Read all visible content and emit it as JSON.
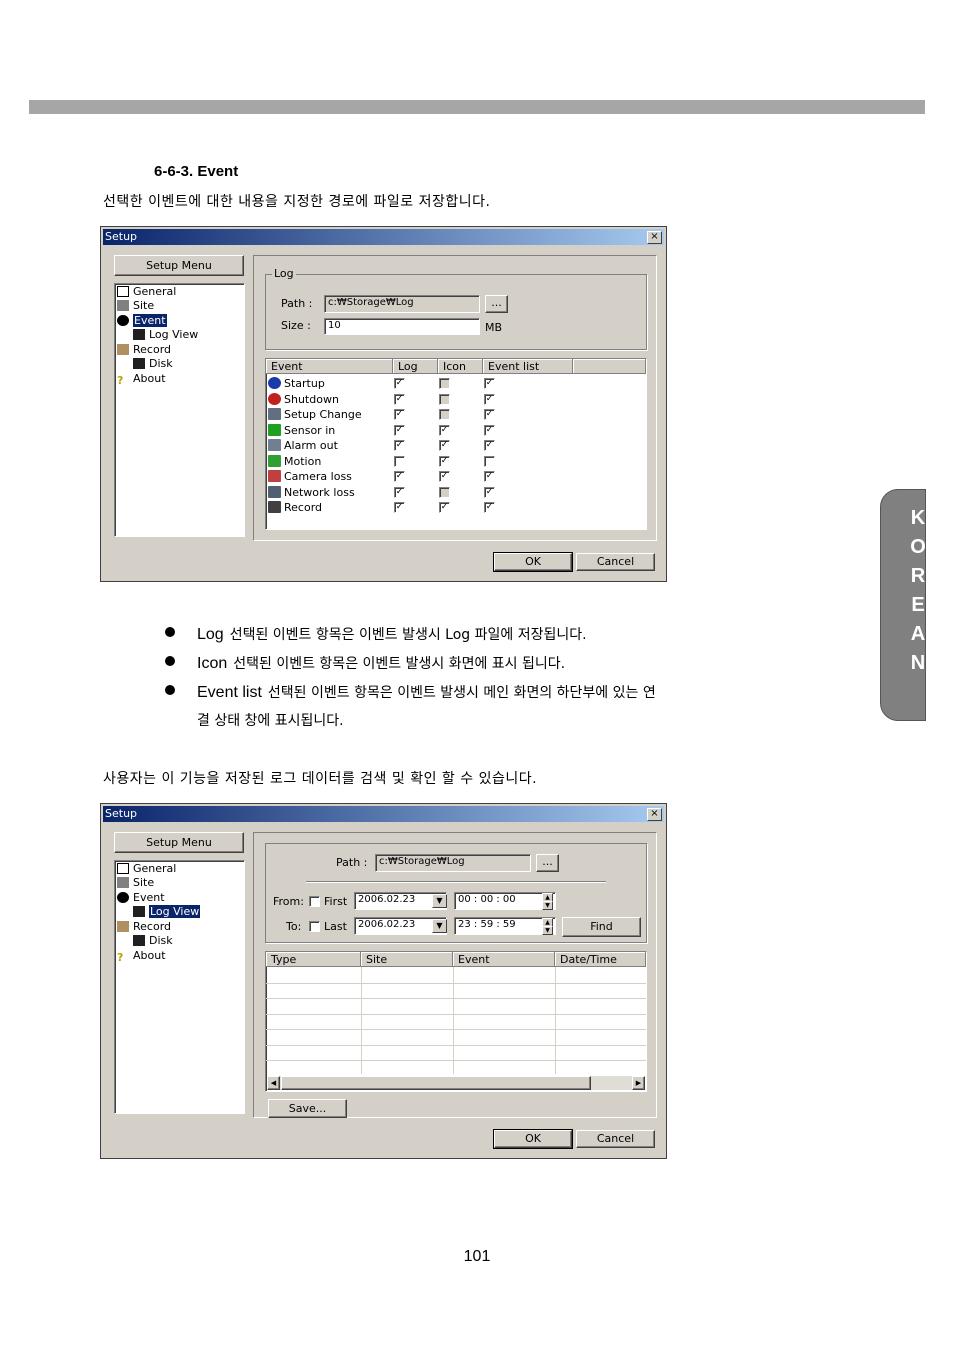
{
  "section_title": "6-6-3. Event",
  "intro_text": "선택한 이벤트에 대한 내용을 지정한 경로에 파일로 저장합니다.",
  "side_tab": [
    "K",
    "O",
    "R",
    "E",
    "A",
    "N"
  ],
  "dialog1": {
    "title": "Setup",
    "close": "×",
    "menu_button": "Setup Menu",
    "tree": [
      "General",
      "Site",
      "Event",
      "Log View",
      "Record",
      "Disk",
      "About"
    ],
    "selected": "Event",
    "group_label": "Log",
    "path_label": "Path :",
    "path_value": "c:₩Storage₩Log",
    "browse": "...",
    "size_label": "Size :",
    "size_value": "10",
    "size_unit": "MB",
    "columns": [
      "Event",
      "Log",
      "Icon",
      "Event list"
    ],
    "events": [
      {
        "name": "Startup",
        "log": true,
        "icon": false,
        "icon_disabled": true,
        "list": true
      },
      {
        "name": "Shutdown",
        "log": true,
        "icon": false,
        "icon_disabled": true,
        "list": true
      },
      {
        "name": "Setup Change",
        "log": true,
        "icon": false,
        "icon_disabled": true,
        "list": true
      },
      {
        "name": "Sensor in",
        "log": true,
        "icon": true,
        "icon_disabled": false,
        "list": true
      },
      {
        "name": "Alarm out",
        "log": true,
        "icon": true,
        "icon_disabled": false,
        "list": true
      },
      {
        "name": "Motion",
        "log": false,
        "icon": true,
        "icon_disabled": false,
        "list": false
      },
      {
        "name": "Camera loss",
        "log": true,
        "icon": true,
        "icon_disabled": false,
        "list": true
      },
      {
        "name": "Network loss",
        "log": true,
        "icon": false,
        "icon_disabled": true,
        "list": true
      },
      {
        "name": "Record",
        "log": true,
        "icon": true,
        "icon_disabled": false,
        "list": true
      }
    ],
    "ok": "OK",
    "cancel": "Cancel"
  },
  "bullets": [
    {
      "term": "Log",
      "text": "선택된 이벤트 항목은 이벤트 발생시 Log 파일에 저장됩니다."
    },
    {
      "term": "Icon",
      "text": "선택된 이벤트 항목은 이벤트 발생시 화면에 표시 됩니다."
    },
    {
      "term": "Event list",
      "text": "선택된 이벤트 항목은 이벤트 발생시 메인 화면의 하단부에 있는 연",
      "text2": "결 상태 창에 표시됩니다."
    }
  ],
  "second_text": "사용자는 이 기능을 저장된 로그 데이터를 검색 및 확인 할 수 있습니다.",
  "dialog2": {
    "title": "Setup",
    "close": "×",
    "menu_button": "Setup Menu",
    "tree": [
      "General",
      "Site",
      "Event",
      "Log View",
      "Record",
      "Disk",
      "About"
    ],
    "selected": "Log View",
    "path_label": "Path :",
    "path_value": "c:₩Storage₩Log",
    "browse": "...",
    "from_label": "From:",
    "first_label": "First",
    "from_date": "2006.02.23",
    "from_time": "00 : 00 : 00",
    "to_label": "To:",
    "last_label": "Last",
    "to_date": "2006.02.23",
    "to_time": "23 : 59 : 59",
    "find": "Find",
    "columns": [
      "Type",
      "Site",
      "Event",
      "Date/Time"
    ],
    "save": "Save...",
    "ok": "OK",
    "cancel": "Cancel"
  },
  "page_number": "101"
}
